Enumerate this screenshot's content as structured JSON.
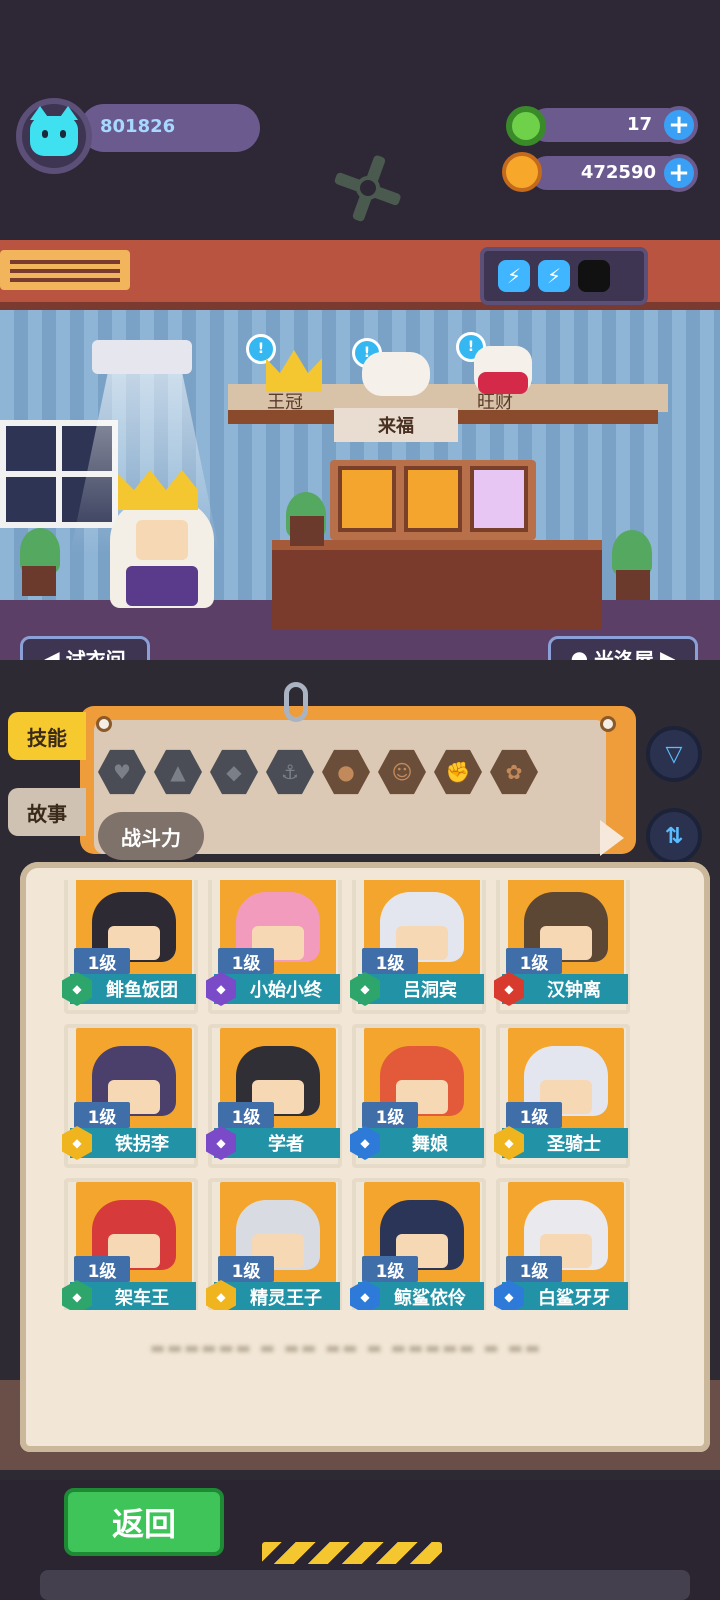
{
  "player": {
    "id": "801826"
  },
  "currencies": [
    {
      "icon": "green-gem-icon",
      "value": "17"
    },
    {
      "icon": "gold-coin-icon",
      "value": "472590"
    }
  ],
  "energy": {
    "filled": 2,
    "total": 3
  },
  "pets": [
    {
      "label": "王冠"
    },
    {
      "label": "来福"
    },
    {
      "label": "旺财"
    }
  ],
  "room_nav": {
    "left": "试衣间",
    "right": "米洛屋"
  },
  "tabs": {
    "skills": "技能",
    "story": "故事"
  },
  "filter_bar": {
    "sort_label": "战斗力"
  },
  "heroes": [
    {
      "level": "1级",
      "name": "鲱鱼饭团",
      "badge": "green",
      "hair": "#2d2a33"
    },
    {
      "level": "1级",
      "name": "小始小终",
      "badge": "purple",
      "hair": "#f29bbd"
    },
    {
      "level": "1级",
      "name": "吕洞宾",
      "badge": "green",
      "hair": "#e3e6ee"
    },
    {
      "level": "1级",
      "name": "汉钟离",
      "badge": "red",
      "hair": "#5c4634"
    },
    {
      "level": "1级",
      "name": "铁拐李",
      "badge": "yellow",
      "hair": "#4b3f6b"
    },
    {
      "level": "1级",
      "name": "学者",
      "badge": "purple",
      "hair": "#2f2f35"
    },
    {
      "level": "1级",
      "name": "舞娘",
      "badge": "blue",
      "hair": "#e35a3a"
    },
    {
      "level": "1级",
      "name": "圣骑士",
      "badge": "yellow",
      "hair": "#e3e6ee"
    },
    {
      "level": "1级",
      "name": "架车王",
      "badge": "green",
      "hair": "#d63a3a"
    },
    {
      "level": "1级",
      "name": "精灵王子",
      "badge": "yellow",
      "hair": "#d9dbe3"
    },
    {
      "level": "1级",
      "name": "鲸鲨依伶",
      "badge": "blue",
      "hair": "#2a3558"
    },
    {
      "level": "1级",
      "name": "白鲨牙牙",
      "badge": "blue",
      "hair": "#e9e9ee"
    }
  ],
  "back_button": "返回",
  "colors": {
    "accent_orange": "#ef9c3a",
    "name_bar": "#2293a6",
    "back_green": "#3fc45a"
  }
}
